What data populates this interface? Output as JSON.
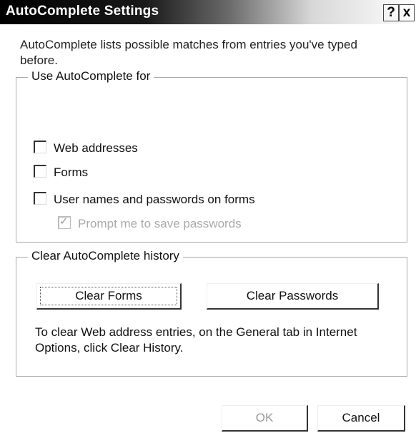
{
  "window": {
    "title": "AutoComplete Settings",
    "help_label": "?",
    "close_label": "x"
  },
  "intro_text": "AutoComplete lists possible matches from entries you've typed before.",
  "use_group": {
    "legend": "Use AutoComplete for",
    "items": [
      {
        "label": "Web addresses",
        "checked": false,
        "enabled": true
      },
      {
        "label": "Forms",
        "checked": false,
        "enabled": true
      },
      {
        "label": "User names and passwords on forms",
        "checked": false,
        "enabled": true
      },
      {
        "label": "Prompt me to save passwords",
        "checked": true,
        "enabled": false
      }
    ]
  },
  "clear_group": {
    "legend": "Clear AutoComplete history",
    "clear_forms_label": "Clear Forms",
    "clear_passwords_label": "Clear Passwords",
    "note": "To clear Web address entries, on the General tab in Internet Options, click Clear History."
  },
  "footer": {
    "ok_label": "OK",
    "cancel_label": "Cancel"
  }
}
